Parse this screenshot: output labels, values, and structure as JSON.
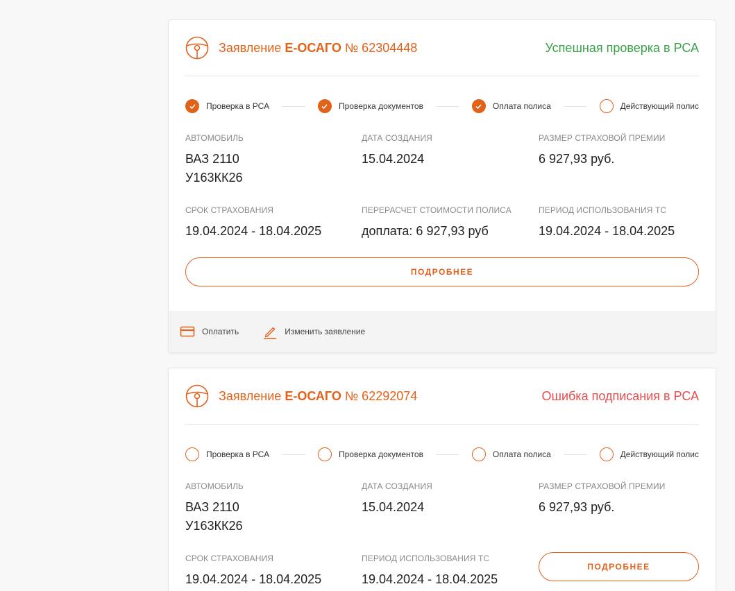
{
  "applications": [
    {
      "title_prefix": "Заявление",
      "title_product": "Е-ОСАГО",
      "title_number": "№ 62304448",
      "status": "Успешная проверка в РСА",
      "status_color": "#3aa34a",
      "steps": [
        {
          "label": "Проверка в РСА",
          "done": true
        },
        {
          "label": "Проверка документов",
          "done": true
        },
        {
          "label": "Оплата полиса",
          "done": true
        },
        {
          "label": "Действующий полис",
          "done": false
        }
      ],
      "car_label": "АВТОМОБИЛЬ",
      "car_model": "ВАЗ 2110",
      "car_plate": "У163КК26",
      "created_label": "ДАТА СОЗДАНИЯ",
      "created_value": "15.04.2024",
      "premium_label": "РАЗМЕР СТРАХОВОЙ ПРЕМИИ",
      "premium_value": "6 927,93 руб.",
      "term_label": "СРОК СТРАХОВАНИЯ",
      "term_value": "19.04.2024 - 18.04.2025",
      "recalc_label": "ПЕРЕРАСЧЕТ СТОИМОСТИ ПОЛИСА",
      "recalc_value": "доплата: 6 927,93 руб",
      "usage_label": "ПЕРИОД ИСПОЛЬЗОВАНИЯ ТС",
      "usage_value": "19.04.2024 - 18.04.2025",
      "details_button": "ПОДРОБНЕЕ",
      "footer": {
        "pay_label": "Оплатить",
        "edit_label": "Изменить заявление"
      }
    },
    {
      "title_prefix": "Заявление",
      "title_product": "Е-ОСАГО",
      "title_number": "№ 62292074",
      "status": "Ошибка подписания в РСА",
      "status_color": "#e84b4b",
      "steps": [
        {
          "label": "Проверка в РСА",
          "done": false
        },
        {
          "label": "Проверка документов",
          "done": false
        },
        {
          "label": "Оплата полиса",
          "done": false
        },
        {
          "label": "Действующий полис",
          "done": false
        }
      ],
      "car_label": "АВТОМОБИЛЬ",
      "car_model": "ВАЗ 2110",
      "car_plate": "У163КК26",
      "created_label": "ДАТА СОЗДАНИЯ",
      "created_value": "15.04.2024",
      "premium_label": "РАЗМЕР СТРАХОВОЙ ПРЕМИИ",
      "premium_value": "6 927,93 руб.",
      "term_label": "СРОК СТРАХОВАНИЯ",
      "term_value": "19.04.2024 - 18.04.2025",
      "usage_label": "ПЕРИОД ИСПОЛЬЗОВАНИЯ ТС",
      "usage_value": "19.04.2024 - 18.04.2025",
      "details_button": "ПОДРОБНЕЕ"
    }
  ],
  "colors": {
    "accent": "#e2621a",
    "success": "#3aa34a",
    "error": "#e84b4b"
  }
}
